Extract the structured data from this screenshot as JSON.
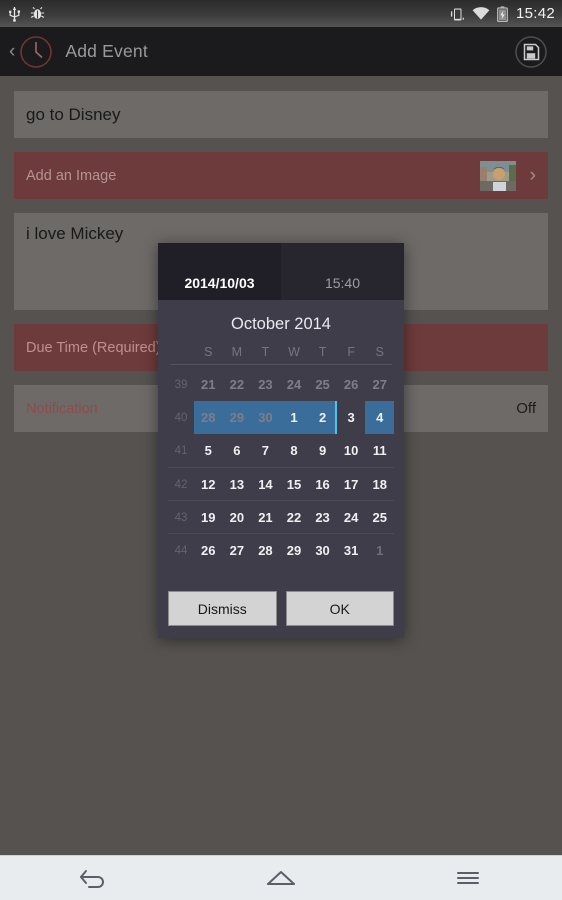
{
  "status_bar": {
    "icons": [
      "usb-icon",
      "bug-icon",
      "vibrate-icon",
      "wifi-icon",
      "battery-charging-icon"
    ],
    "clock": "15:42"
  },
  "app_bar": {
    "back_label": "‹",
    "logo": "clock-icon",
    "title": "Add Event",
    "save_icon": "save-floppy-icon"
  },
  "form": {
    "title_value": "go to Disney",
    "image_label": "Add an Image",
    "image_chevron": "›",
    "description_value": "i love Mickey",
    "due_time_label": "Due Time (Required)",
    "notification_label": "Notification",
    "notification_value": "Off"
  },
  "dialog": {
    "tab_date": "2014/10/03",
    "tab_time": "15:40",
    "month_title": "October 2014",
    "weekdays": [
      "S",
      "M",
      "T",
      "W",
      "T",
      "F",
      "S"
    ],
    "weeks": [
      {
        "number": "39",
        "days": [
          {
            "d": "21",
            "style": "other"
          },
          {
            "d": "22",
            "style": "other"
          },
          {
            "d": "23",
            "style": "other"
          },
          {
            "d": "24",
            "style": "other"
          },
          {
            "d": "25",
            "style": "other"
          },
          {
            "d": "26",
            "style": "other"
          },
          {
            "d": "27",
            "style": "other"
          }
        ]
      },
      {
        "number": "40",
        "selected": true,
        "days": [
          {
            "d": "28",
            "style": "other sel-bg"
          },
          {
            "d": "29",
            "style": "other sel-bg"
          },
          {
            "d": "30",
            "style": "other sel-bg"
          },
          {
            "d": "1",
            "style": "sel-bg"
          },
          {
            "d": "2",
            "style": "sel-bg"
          },
          {
            "d": "3",
            "style": "today"
          },
          {
            "d": "4",
            "style": "sel-bg"
          }
        ]
      },
      {
        "number": "41",
        "days": [
          {
            "d": "5"
          },
          {
            "d": "6"
          },
          {
            "d": "7"
          },
          {
            "d": "8"
          },
          {
            "d": "9"
          },
          {
            "d": "10"
          },
          {
            "d": "11"
          }
        ]
      },
      {
        "number": "42",
        "days": [
          {
            "d": "12"
          },
          {
            "d": "13"
          },
          {
            "d": "14"
          },
          {
            "d": "15"
          },
          {
            "d": "16"
          },
          {
            "d": "17"
          },
          {
            "d": "18"
          }
        ]
      },
      {
        "number": "43",
        "days": [
          {
            "d": "19"
          },
          {
            "d": "20"
          },
          {
            "d": "21"
          },
          {
            "d": "22"
          },
          {
            "d": "23"
          },
          {
            "d": "24"
          },
          {
            "d": "25"
          }
        ]
      },
      {
        "number": "44",
        "days": [
          {
            "d": "26"
          },
          {
            "d": "27"
          },
          {
            "d": "28"
          },
          {
            "d": "29"
          },
          {
            "d": "30"
          },
          {
            "d": "31"
          },
          {
            "d": "1",
            "style": "dim"
          }
        ]
      }
    ],
    "dismiss_label": "Dismiss",
    "ok_label": "OK"
  },
  "nav_bar": {
    "back_icon": "back-arrow-icon",
    "home_icon": "home-icon",
    "menu_icon": "menu-icon"
  },
  "colors": {
    "accent_red": "#6d3b3b",
    "field_gray": "#6d6a68",
    "page_bg": "#55524f",
    "dialog_bg": "#3e3d49",
    "selection_blue": "#3a6d99",
    "today_cyan": "#4fc3e8"
  }
}
